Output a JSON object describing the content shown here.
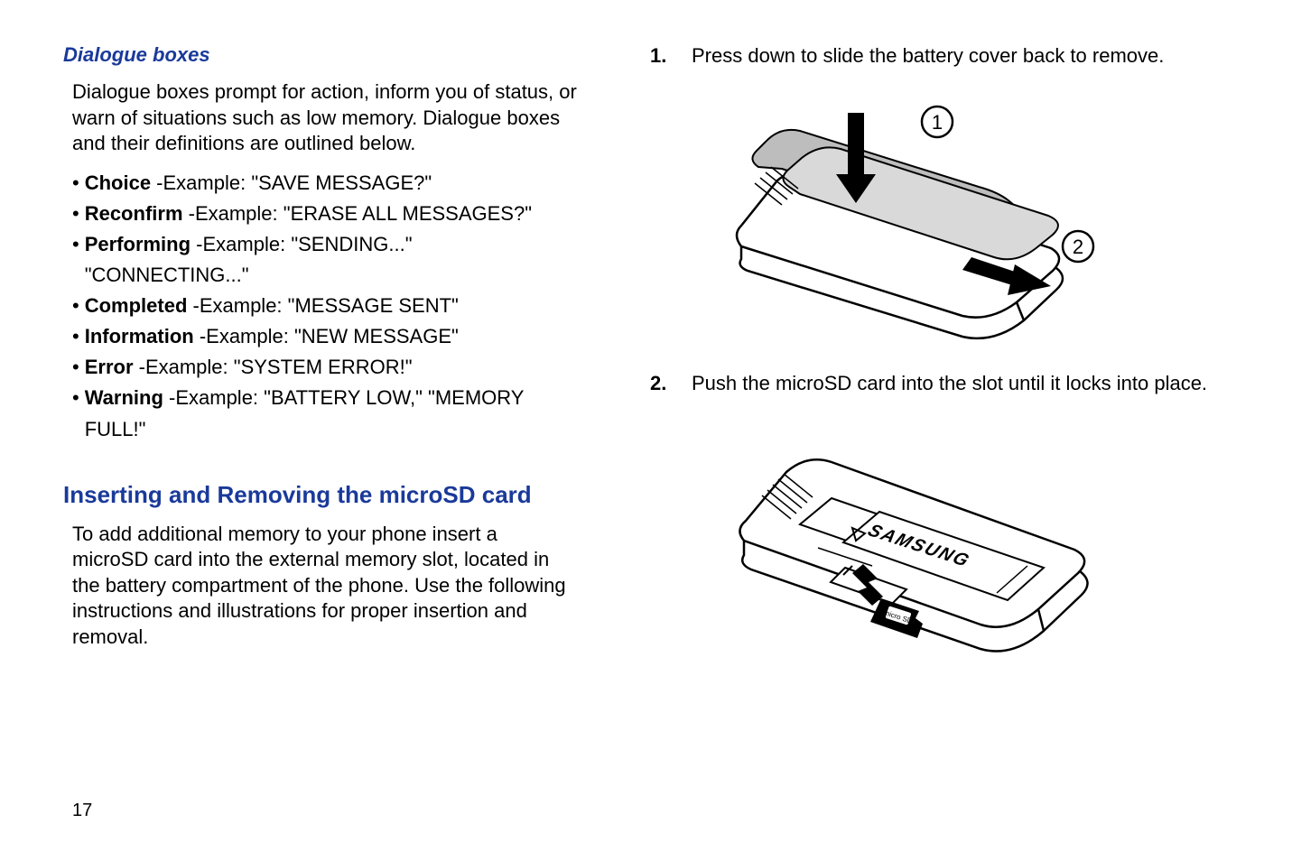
{
  "left": {
    "subheading": "Dialogue boxes",
    "intro": "Dialogue boxes prompt for action, inform you of status, or warn of situations such as low memory. Dialogue boxes and their definitions are outlined below.",
    "bullets": [
      {
        "label": "Choice",
        "rest": " -Example: \"SAVE MESSAGE?\""
      },
      {
        "label": "Reconfirm",
        "rest": " -Example: \"ERASE ALL MESSAGES?\""
      },
      {
        "label": "Performing",
        "rest": " -Example: \"SENDING...\" \"CONNECTING...\""
      },
      {
        "label": "Completed",
        "rest": " -Example: \"MESSAGE SENT\""
      },
      {
        "label": "Information",
        "rest": " -Example: \"NEW MESSAGE\""
      },
      {
        "label": "Error",
        "rest": " -Example: \"SYSTEM ERROR!\""
      },
      {
        "label": "Warning",
        "rest": " -Example: \"BATTERY LOW,\" \"MEMORY FULL!\""
      }
    ],
    "section": "Inserting and Removing the microSD card",
    "section_body": "To add additional memory to your phone insert a microSD card into the external memory slot, located in the battery compartment of the phone. Use the following instructions and illustrations for proper insertion and removal."
  },
  "right": {
    "steps": [
      {
        "num": "1.",
        "text": "Press down to slide the battery cover back to remove."
      },
      {
        "num": "2.",
        "text": "Push the microSD card into the slot until it locks into place."
      }
    ],
    "fig1_labels": {
      "a": "1",
      "b": "2"
    },
    "fig2_brand": "SAMSUNG"
  },
  "page_number": "17"
}
